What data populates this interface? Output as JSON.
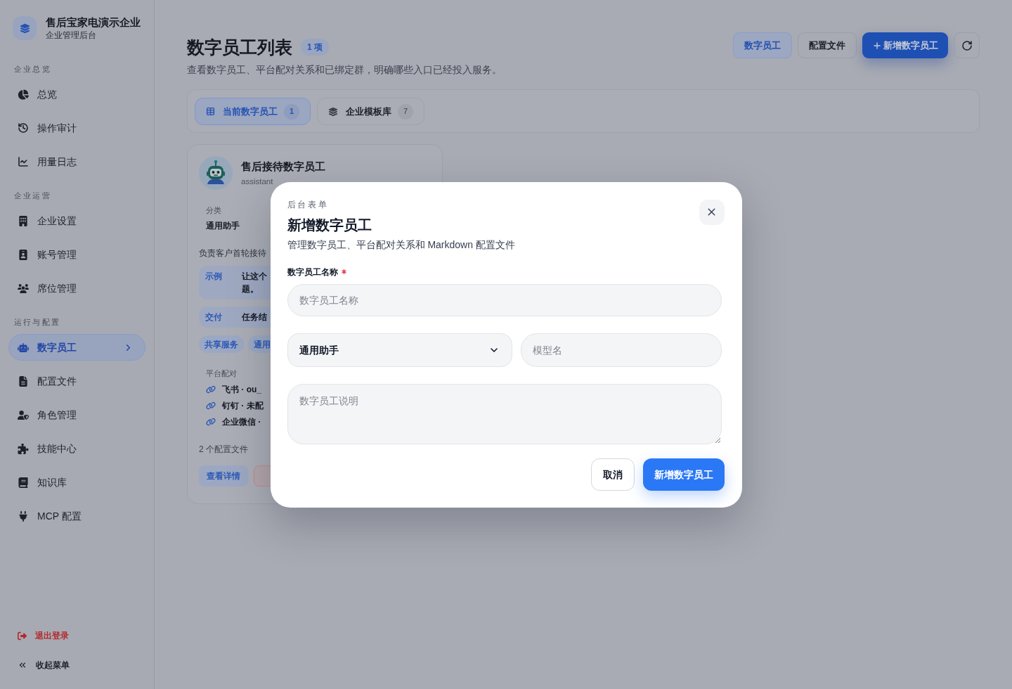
{
  "sidebar": {
    "brand": {
      "title": "售后宝家电演示企业",
      "subtitle": "企业管理后台"
    },
    "sections": [
      {
        "title": "企业总览",
        "items": [
          {
            "label": "总览",
            "selected": false
          },
          {
            "label": "操作审计",
            "selected": false
          },
          {
            "label": "用量日志",
            "selected": false
          }
        ]
      },
      {
        "title": "企业运营",
        "items": [
          {
            "label": "企业设置",
            "selected": false
          },
          {
            "label": "账号管理",
            "selected": false
          },
          {
            "label": "席位管理",
            "selected": false
          }
        ]
      },
      {
        "title": "运行与配置",
        "items": [
          {
            "label": "数字员工",
            "selected": true
          },
          {
            "label": "配置文件",
            "selected": false
          },
          {
            "label": "角色管理",
            "selected": false
          },
          {
            "label": "技能中心",
            "selected": false
          },
          {
            "label": "知识库",
            "selected": false
          },
          {
            "label": "MCP 配置",
            "selected": false
          }
        ]
      }
    ],
    "footer": [
      {
        "label": "退出登录",
        "kind": "danger"
      },
      {
        "label": "收起菜单",
        "kind": "plain"
      }
    ]
  },
  "header": {
    "title": "数字员工列表",
    "count": "1 项",
    "subtitle": "查看数字员工、平台配对关系和已绑定群，明确哪些入口已经投入服务。",
    "actions": [
      {
        "label": "数字员工",
        "kind": "soft"
      },
      {
        "label": "配置文件",
        "kind": "outline"
      },
      {
        "label": "新增数字员工",
        "kind": "primary"
      },
      {
        "kind": "refresh"
      }
    ]
  },
  "tabs": [
    {
      "label": "当前数字员工",
      "count": "1",
      "selected": true
    },
    {
      "label": "企业模板库",
      "count": "7",
      "selected": false
    }
  ],
  "card": {
    "name": "售后接待数字员工",
    "role": "assistant",
    "category_label": "分类",
    "category": "通用助手",
    "summary": "负责客户首轮接待",
    "details": [
      {
        "label": "示例",
        "lines": [
          "让这个",
          "题。"
        ]
      },
      {
        "label": "交付",
        "lines": [
          "任务结"
        ]
      }
    ],
    "tags": [
      "共享服务",
      "通用"
    ],
    "platform_label": "平台配对",
    "platforms": [
      "飞书 · ou_",
      "钉钉 · 未配",
      "企业微信 ·"
    ],
    "files": "2 个配置文件",
    "actions": [
      {
        "label": "查看详情",
        "kind": "soft"
      },
      {
        "kind": "danger"
      }
    ]
  },
  "modal": {
    "eyebrow": "后台表单",
    "title": "新增数字员工",
    "description": "管理数字员工、平台配对关系和 Markdown 配置文件",
    "fields": [
      {
        "kind": "text",
        "label": "数字员工名称",
        "required": true,
        "placeholder": "数字员工名称"
      },
      {
        "kind": "select",
        "value": "通用助手"
      },
      {
        "kind": "text",
        "placeholder": "模型名"
      },
      {
        "kind": "textarea",
        "placeholder": "数字员工说明"
      }
    ],
    "buttons": [
      {
        "label": "取消",
        "kind": "secondary"
      },
      {
        "label": "新增数字员工",
        "kind": "primary"
      }
    ]
  }
}
